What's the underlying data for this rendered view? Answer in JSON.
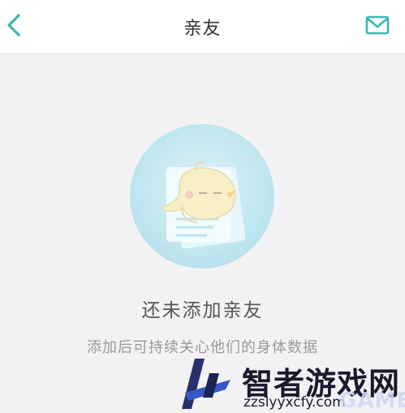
{
  "header": {
    "title": "亲友",
    "back_icon": "chevron-left-icon",
    "mail_icon": "envelope-icon",
    "accent_color": "#3ab7b0"
  },
  "empty_state": {
    "illustration": "bird-mascot-with-papers",
    "title": "还未添加亲友",
    "description": "添加后可持续关心他们的身体数据"
  },
  "watermark": {
    "brand": "智者游戏网",
    "url": "zzslyyxcfy.com",
    "overlay": "GAME"
  }
}
